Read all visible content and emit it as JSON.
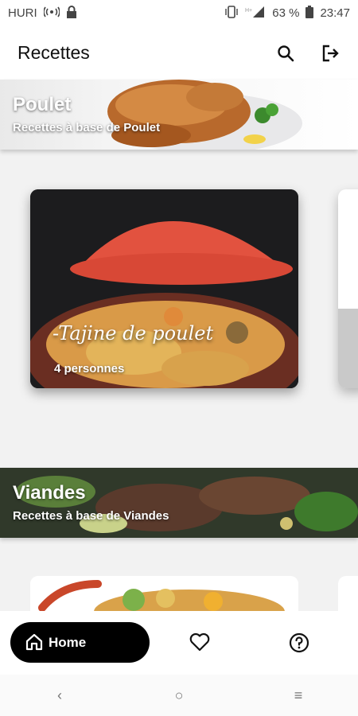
{
  "status_bar": {
    "carrier": "HURI",
    "signal_icon": "hotspot-icon",
    "lock_icon": "lock-icon",
    "battery": "63 %",
    "time": "23:47"
  },
  "app_bar": {
    "title": "Recettes",
    "search_icon": "search-icon",
    "logout_icon": "logout-icon"
  },
  "categories": [
    {
      "title": "Poulet",
      "subtitle": "Recettes à base de Poulet"
    },
    {
      "title": "Viandes",
      "subtitle": "Recettes à base de Viandes"
    }
  ],
  "recipe_card": {
    "title": "-Tajine de poulet",
    "servings": "4 personnes"
  },
  "bottom_nav": {
    "home_label": "Home",
    "home_icon": "home-icon",
    "favorites_icon": "heart-icon",
    "help_icon": "help-icon"
  },
  "system_nav": {
    "back": "‹",
    "home": "○",
    "menu": "≡"
  },
  "colors": {
    "accent": "#000000",
    "tajine_lid": "#e2523f"
  }
}
